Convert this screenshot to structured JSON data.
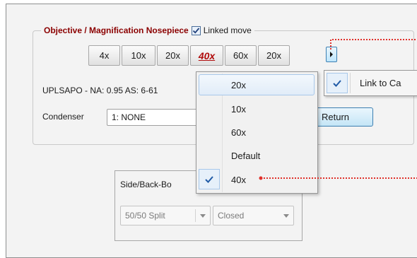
{
  "nosepiece": {
    "title": "Objective / Magnification Nosepiece",
    "linked_move_label": "Linked move",
    "linked_move_checked": true,
    "objectives": [
      "4x",
      "10x",
      "20x",
      "40x",
      "60x",
      "20x"
    ],
    "active_objective": "40x"
  },
  "info_line": "UPLSAPO - NA: 0.95 AS: 6-61",
  "condenser": {
    "label": "Condenser",
    "selected": "1: NONE"
  },
  "return_label": "Return",
  "link_popup": {
    "label": "Link to Ca",
    "checked": true
  },
  "dropdown": {
    "items": [
      "20x",
      "10x",
      "60x",
      "Default",
      "40x"
    ],
    "highlighted": "20x",
    "checked": "40x"
  },
  "side_back": {
    "title": "Side/Back-Bo",
    "split_selected": "50/50 Split",
    "state_selected": "Closed"
  },
  "colors": {
    "accent_red": "#b10c0c",
    "title_red": "#8b0000",
    "check_blue": "#1f5aa6",
    "link_dots": "#e0302a"
  },
  "icons": {
    "expand": "chevron-right-icon",
    "check": "checkmark-icon",
    "dropdown": "chevron-down-icon"
  }
}
